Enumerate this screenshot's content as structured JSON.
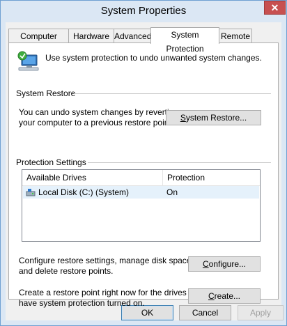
{
  "window": {
    "title": "System Properties",
    "close_glyph": "✕"
  },
  "tabs": [
    {
      "label": "Computer Name"
    },
    {
      "label": "Hardware"
    },
    {
      "label": "Advanced"
    },
    {
      "label": "System Protection",
      "selected": true
    },
    {
      "label": "Remote"
    }
  ],
  "intro": {
    "icon": "system-protection-icon",
    "text": "Use system protection to undo unwanted system changes."
  },
  "system_restore": {
    "heading": "System Restore",
    "description_line1": "You can undo system changes by reverting",
    "description_line2": "your computer to a previous restore point.",
    "button_label_accel": "S",
    "button_label_rest": "ystem Restore..."
  },
  "protection": {
    "heading": "Protection Settings",
    "columns": [
      "Available Drives",
      "Protection"
    ],
    "rows": [
      {
        "drive": "Local Disk (C:) (System)",
        "protection": "On",
        "icon": "drive-icon"
      }
    ],
    "configure_text_line1": "Configure restore settings, manage disk space,",
    "configure_text_line2": "and delete restore points.",
    "configure_accel": "C",
    "configure_rest": "onfigure...",
    "create_text_line1": "Create a restore point right now for the drives that",
    "create_text_line2": "have system protection turned on.",
    "create_accel": "C",
    "create_rest": "reate..."
  },
  "footer": {
    "ok": "OK",
    "cancel": "Cancel",
    "apply": "Apply"
  },
  "colors": {
    "frame": "#dbe7f4",
    "frame_border": "#6e9fd1",
    "close": "#c75050",
    "selection": "#e5f1fb"
  }
}
